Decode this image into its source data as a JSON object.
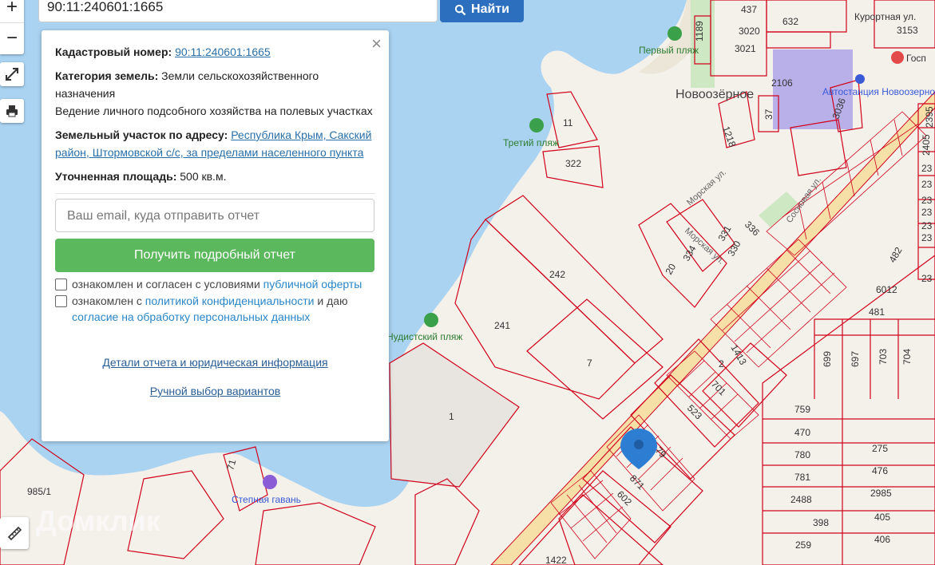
{
  "search": {
    "value": "90:11:240601:1665",
    "button_label": "Найти"
  },
  "controls": {
    "zoom_in": "+",
    "zoom_out": "−"
  },
  "panel": {
    "close_symbol": "×",
    "cadastral_label": "Кадастровый номер:",
    "cadastral_value": "90:11:240601:1665",
    "category_label": "Категория земель:",
    "category_value": "Земли сельскохозяйственного назначения",
    "usage": "Ведение личного подсобного хозяйства на полевых участках",
    "address_label": "Земельный участок по адресу:",
    "address_value": "Республика Крым, Сакский район, Штормовской с/с, за пределами населенного пункта",
    "area_label": "Уточненная площадь:",
    "area_value": "500 кв.м.",
    "email_placeholder": "Ваш email, куда отправить отчет",
    "get_report_button": "Получить подробный отчет",
    "checkbox1_text": "ознакомлен и согласен с условиями",
    "checkbox1_link": "публичной оферты",
    "checkbox2_text_a": "ознакомлен с",
    "checkbox2_link1": "политикой конфиденциальности",
    "checkbox2_text_b": "и даю",
    "checkbox2_link2": "согласие на обработку персональных данных",
    "details_link": "Детали отчета и юридическая информация",
    "manual_link": "Ручной выбор вариантов"
  },
  "map": {
    "town": "Новоозёрное",
    "pois": [
      "Первый пляж",
      "Третий пляж",
      "Нудистский пляж",
      "Степная гавань",
      "Автостанция Новоозерное",
      "Курортная ул.",
      "Госп"
    ],
    "streets": [
      "Морская ул.",
      "Морская ул.",
      "Сосновая ул."
    ],
    "parcels": [
      "437",
      "632",
      "1189",
      "3020",
      "3021",
      "3153",
      "2106",
      "37",
      "3036",
      "1218",
      "11",
      "322",
      "242",
      "241",
      "7",
      "1",
      "331",
      "336",
      "330",
      "334",
      "20",
      "2",
      "1413",
      "701",
      "523",
      "79",
      "871",
      "602",
      "1422",
      "71",
      "985/1",
      "482",
      "6012",
      "481",
      "699",
      "697",
      "703",
      "704",
      "759",
      "470",
      "780",
      "781",
      "2488",
      "398",
      "259",
      "275",
      "476",
      "2985",
      "405",
      "406",
      "2405",
      "2395",
      "23",
      "23",
      "23",
      "23",
      "23",
      "23",
      "23"
    ],
    "watermark": "Домклик"
  },
  "colors": {
    "water": "#aad3f2",
    "parcel_border": "#d0021b",
    "button_blue": "#2c6fbf",
    "button_green": "#5cb85c",
    "marker": "#2d7ed2"
  }
}
